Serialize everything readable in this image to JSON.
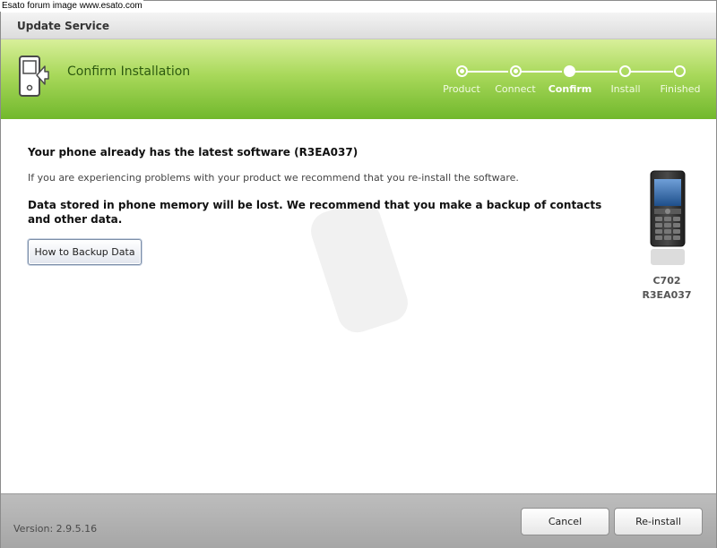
{
  "watermark": "Esato forum image www.esato.com",
  "window": {
    "title": "Update Service"
  },
  "header": {
    "title": "Confirm Installation",
    "icon": "phone-update-icon",
    "steps": [
      {
        "label": "Product",
        "state": "done"
      },
      {
        "label": "Connect",
        "state": "done"
      },
      {
        "label": "Confirm",
        "state": "active"
      },
      {
        "label": "Install",
        "state": "pending"
      },
      {
        "label": "Finished",
        "state": "pending"
      }
    ]
  },
  "main": {
    "headline": "Your phone already has the latest software (R3EA037)",
    "info": "If you are experiencing problems with your product we recommend that you re-install the software.",
    "warning": "Data stored in phone memory will be lost. We recommend that you make a backup of contacts and other data.",
    "backup_button": "How to Backup Data"
  },
  "device": {
    "model": "C702",
    "firmware": "R3EA037",
    "icon": "mobile-phone-icon"
  },
  "footer": {
    "version": "Version: 2.9.5.16",
    "cancel_label": "Cancel",
    "reinstall_label": "Re-install"
  },
  "colors": {
    "header_green": "#8cc63f",
    "header_title": "#2d5a10",
    "footer_gray": "#b0b0b0"
  }
}
